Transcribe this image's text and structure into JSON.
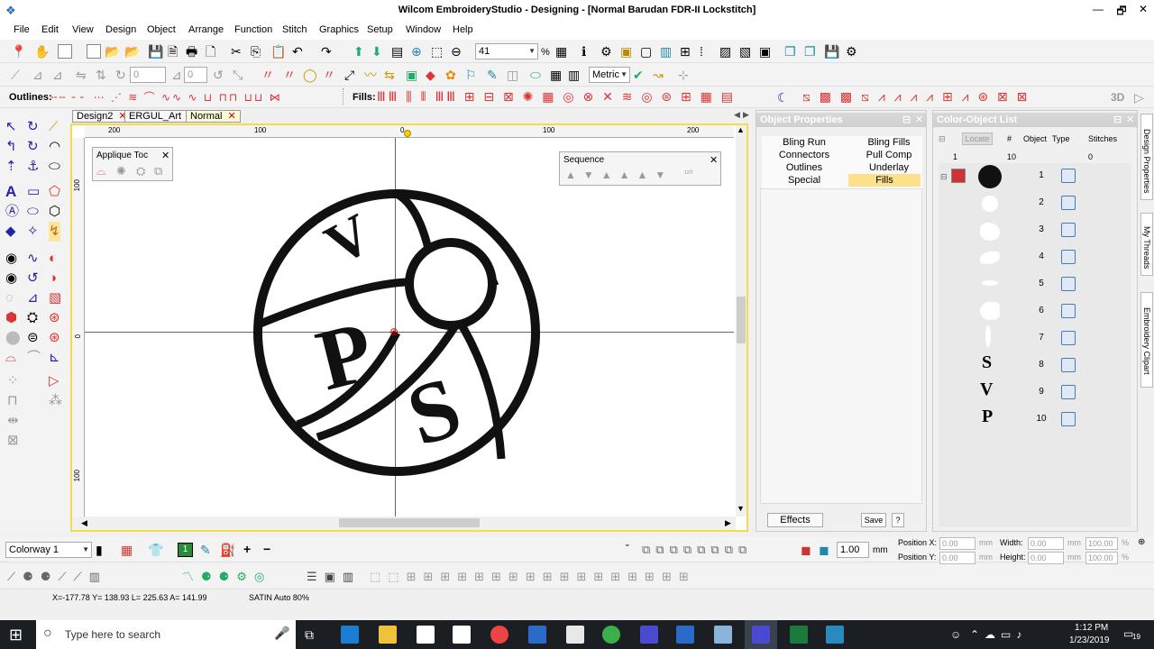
{
  "window": {
    "title": "Wilcom EmbroideryStudio - Designing - [Normal      Barudan FDR-II Lockstitch]",
    "minimize": "—",
    "maximize": "🗗",
    "close": "✕"
  },
  "menu": [
    "File",
    "Edit",
    "View",
    "Design",
    "Object",
    "Arrange",
    "Function",
    "Stitch",
    "Graphics",
    "Setup",
    "Window",
    "Help"
  ],
  "toolbar1": {
    "zoom_value": "41",
    "zoom_unit": "%"
  },
  "toolbar2": {
    "rotate_value": "0",
    "slant_value": "0",
    "units_value": "Metric"
  },
  "toolbar3": {
    "outlines_label": "Outlines:",
    "fills_label": "Fills:",
    "three_d_label": "3D"
  },
  "doc_tabs": [
    {
      "label": "Design2",
      "close": "✕"
    },
    {
      "label": "ERGUL_Art",
      "close": "✕"
    },
    {
      "label": "Normal",
      "close": "✕",
      "active": true
    }
  ],
  "ruler": {
    "h_labels": [
      "200",
      "100",
      "0",
      "100",
      "200"
    ],
    "v_labels": [
      "100",
      "0",
      "100"
    ]
  },
  "applique_toolbar": {
    "title": "Applique Toc",
    "close": "✕"
  },
  "sequence_toolbar": {
    "title": "Sequence",
    "close": "✕"
  },
  "design_text": {
    "letter_v": "V",
    "letter_p": "P",
    "letter_s": "S"
  },
  "object_properties": {
    "title": "Object Properties",
    "tabs_left": [
      "Bling Run",
      "Connectors",
      "Outlines",
      "Special"
    ],
    "tabs_right": [
      "Bling Fills",
      "Pull Comp",
      "Underlay",
      "Fills"
    ],
    "active_tab": "Fills",
    "effects_button": "Effects",
    "save_button": "Save",
    "help_button": "?"
  },
  "color_object_list": {
    "title": "Color-Object List",
    "locate_button": "Locate",
    "headers": [
      "#",
      "Object",
      "Type",
      "Stitches"
    ],
    "summary": {
      "group": "1",
      "count": "10",
      "stitches": "0"
    },
    "rows": [
      "1",
      "2",
      "3",
      "4",
      "5",
      "6",
      "7",
      "8",
      "9",
      "10"
    ],
    "row_letters": {
      "8": "S",
      "9": "V",
      "10": "P"
    }
  },
  "side_tabs": [
    "Design Properties",
    "My Threads",
    "Embroidery Clipart"
  ],
  "bottom_toolbar": {
    "colorway": "Colorway 1",
    "thread_number": "1",
    "scale_value": "1.00",
    "scale_unit": "mm",
    "position_x_label": "Position X:",
    "position_y_label": "Position Y:",
    "position_x": "0.00",
    "position_y": "0.00",
    "pos_unit": "mm",
    "width_label": "Width:",
    "height_label": "Height:",
    "width": "0.00",
    "height": "0.00",
    "width_pct": "100.00",
    "height_pct": "100.00",
    "pct_unit": "%"
  },
  "status": {
    "coords": "X=-177.78 Y= 138.93 L= 225.63 A= 141.99",
    "stitch_type": "SATIN Auto 80%"
  },
  "taskbar": {
    "search_placeholder": "Type here to search",
    "time": "1:12 PM",
    "date": "1/23/2019",
    "notification_count": "19"
  },
  "colors": {
    "accent_active_tab": "#fffbd8",
    "design_black": "#111111",
    "taskbar": "#1b1f24"
  }
}
